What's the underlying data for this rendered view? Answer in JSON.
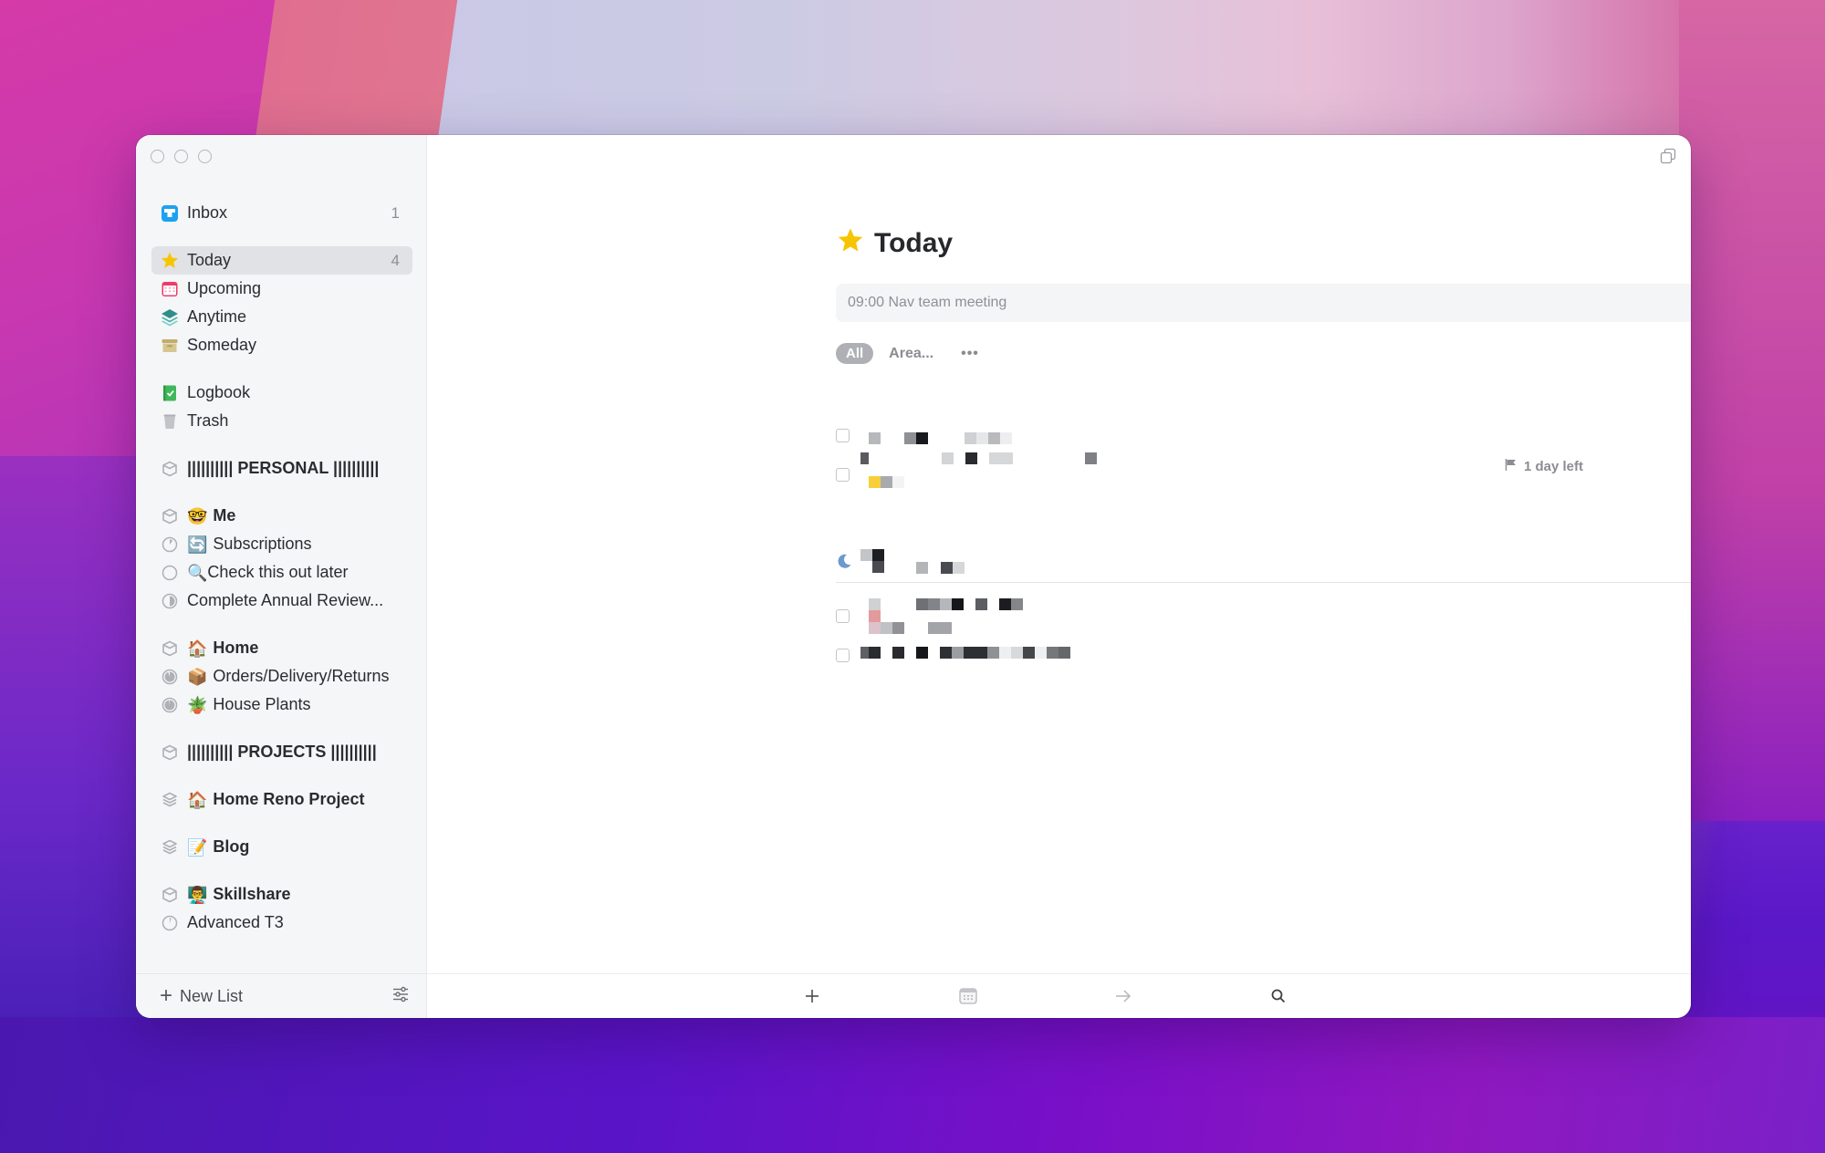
{
  "window": {
    "traffic_lights": [
      "close",
      "minimize",
      "zoom"
    ],
    "restore_icon": "window-restore-icon"
  },
  "sidebar": {
    "inbox": {
      "label": "Inbox",
      "count": "1",
      "icon": "inbox-tray-icon",
      "color": "#1da1f2"
    },
    "smart_lists": [
      {
        "label": "Today",
        "count": "4",
        "icon": "star-icon",
        "selected": true,
        "color": "#f7c500"
      },
      {
        "label": "Upcoming",
        "count": "",
        "icon": "calendar-icon",
        "color": "#f03a6a"
      },
      {
        "label": "Anytime",
        "count": "",
        "icon": "layers-icon",
        "color": "#3a9c95"
      },
      {
        "label": "Someday",
        "count": "",
        "icon": "archive-box-icon",
        "color": "#c9b77a"
      }
    ],
    "logs": [
      {
        "label": "Logbook",
        "icon": "logbook-icon",
        "color": "#40b85a"
      },
      {
        "label": "Trash",
        "icon": "trash-icon",
        "color": "#b9bbbf"
      }
    ],
    "areas": [
      {
        "type": "area",
        "label": "|||||||||| PERSONAL ||||||||||",
        "emoji": ""
      },
      {
        "type": "area",
        "label": "Me",
        "emoji": "🤓"
      },
      {
        "type": "project",
        "label": "Subscriptions",
        "emoji": "🔄",
        "progress": 0.1
      },
      {
        "type": "project",
        "label": "Check this out later",
        "emoji": "🔍",
        "progress": 0
      },
      {
        "type": "project",
        "label": "Complete Annual Review...",
        "emoji": "",
        "progress": 0.5
      },
      {
        "type": "area",
        "label": "Home",
        "emoji": "🏠"
      },
      {
        "type": "project",
        "label": "Orders/Delivery/Returns",
        "emoji": "📦",
        "progress": 0.9
      },
      {
        "type": "project",
        "label": "House Plants",
        "emoji": "🪴",
        "progress": 0.95
      },
      {
        "type": "area",
        "label": "|||||||||| PROJECTS ||||||||||",
        "emoji": ""
      },
      {
        "type": "area-stack",
        "label": "Home Reno Project",
        "emoji": "🏠"
      },
      {
        "type": "area-stack",
        "label": "Blog",
        "emoji": "📝"
      },
      {
        "type": "area",
        "label": "Skillshare",
        "emoji": "👨‍🏫"
      },
      {
        "type": "project",
        "label": "Advanced T3",
        "emoji": "",
        "progress": 0.05
      }
    ],
    "footer": {
      "new_list_label": "New List",
      "settings_icon": "sliders-icon"
    }
  },
  "main": {
    "title": "Today",
    "title_icon": "star-icon",
    "calendar_event": "09:00 Nav team meeting",
    "filters": {
      "all_label": "All",
      "area_label": "Area...",
      "more_label": "•••"
    },
    "tasks": [
      {
        "title": "[redacted]",
        "deadline": ""
      },
      {
        "title": "[redacted]",
        "deadline": "1 day left",
        "tag": "[redacted]"
      }
    ],
    "evening_section": {
      "icon": "moon-icon",
      "title": "[redacted]"
    },
    "evening_tasks": [
      {
        "title": "[redacted]"
      },
      {
        "title": "[redacted]"
      }
    ],
    "toolbar": {
      "new_todo_icon": "plus-icon",
      "when_icon": "calendar-icon",
      "move_icon": "arrow-right-icon",
      "search_icon": "search-icon"
    }
  },
  "colors": {
    "accent_star": "#f7c500",
    "selected_bg": "#e1e2e6",
    "sidebar_bg": "#f5f6f8",
    "moon": "#6b9ad0"
  }
}
